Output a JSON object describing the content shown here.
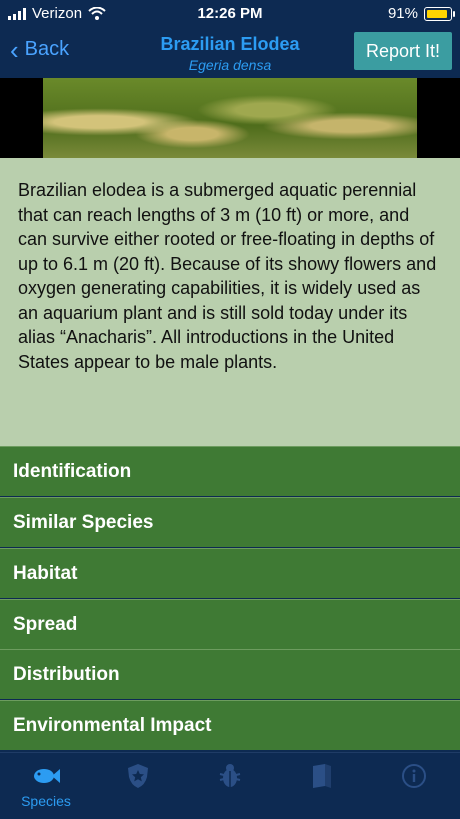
{
  "status": {
    "carrier": "Verizon",
    "time": "12:26 PM",
    "battery": "91%"
  },
  "nav": {
    "back_label": "Back",
    "title": "Brazilian Elodea",
    "subtitle": "Egeria densa",
    "report_label": "Report It!"
  },
  "description": "Brazilian elodea is a submerged aquatic perennial  that can reach lengths of 3 m (10 ft) or more, and  can survive either rooted or free-floating in depths of up to 6.1 m  (20 ft). Because of its showy flowers and oxygen generating capabilities, it is widely used as an aquarium plant and is still sold today under its alias “Anacharis”. All introductions in the United States appear to be male plants.",
  "sections": [
    {
      "label": "Identification"
    },
    {
      "label": "Similar Species"
    },
    {
      "label": "Habitat"
    },
    {
      "label": "Spread"
    },
    {
      "label": "Distribution"
    },
    {
      "label": "Environmental Impact"
    }
  ],
  "tabs": [
    {
      "label": "Species",
      "icon": "fish-icon",
      "active": true
    },
    {
      "label": "",
      "icon": "shield-star-icon"
    },
    {
      "label": "",
      "icon": "bug-icon"
    },
    {
      "label": "",
      "icon": "book-icon"
    },
    {
      "label": "",
      "icon": "info-icon"
    }
  ],
  "colors": {
    "nav_bg": "#0d2a52",
    "accent_blue": "#2c9cf2",
    "report_bg": "#3b9da1",
    "desc_bg": "#b9cfad",
    "section_bg": "#3f7a34"
  }
}
